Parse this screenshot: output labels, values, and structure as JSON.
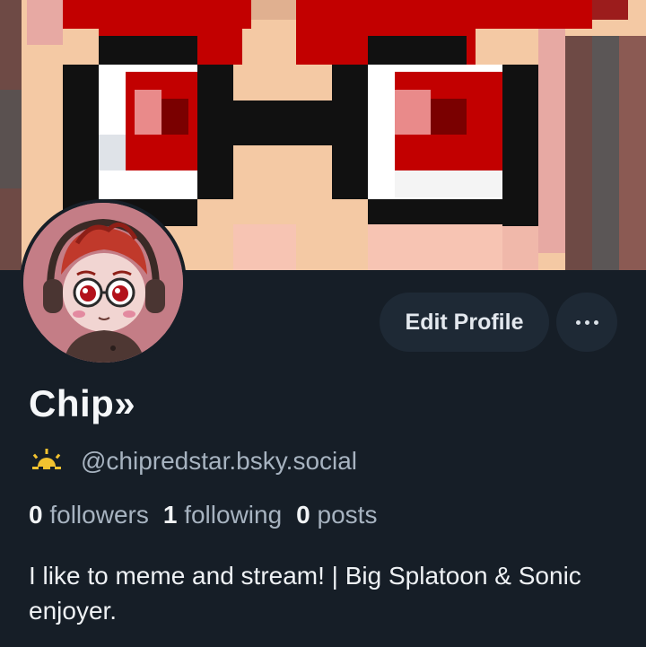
{
  "profile": {
    "display_name": "Chip»",
    "handle": "@chipredstar.bsky.social",
    "handle_icon": "sunrise-icon",
    "bio": "I like to meme and stream! | Big Splatoon & Sonic enjoyer."
  },
  "stats": {
    "followers_count": "0",
    "followers_label": "followers",
    "following_count": "1",
    "following_label": "following",
    "posts_count": "0",
    "posts_label": "posts"
  },
  "actions": {
    "edit_profile_label": "Edit Profile",
    "more_icon": "ellipsis-icon"
  },
  "colors": {
    "background": "#161e27",
    "button_bg": "#1e2935",
    "secondary_text": "#a7b3c0",
    "banner_red": "#c20000",
    "banner_skin": "#f4c9a4"
  }
}
